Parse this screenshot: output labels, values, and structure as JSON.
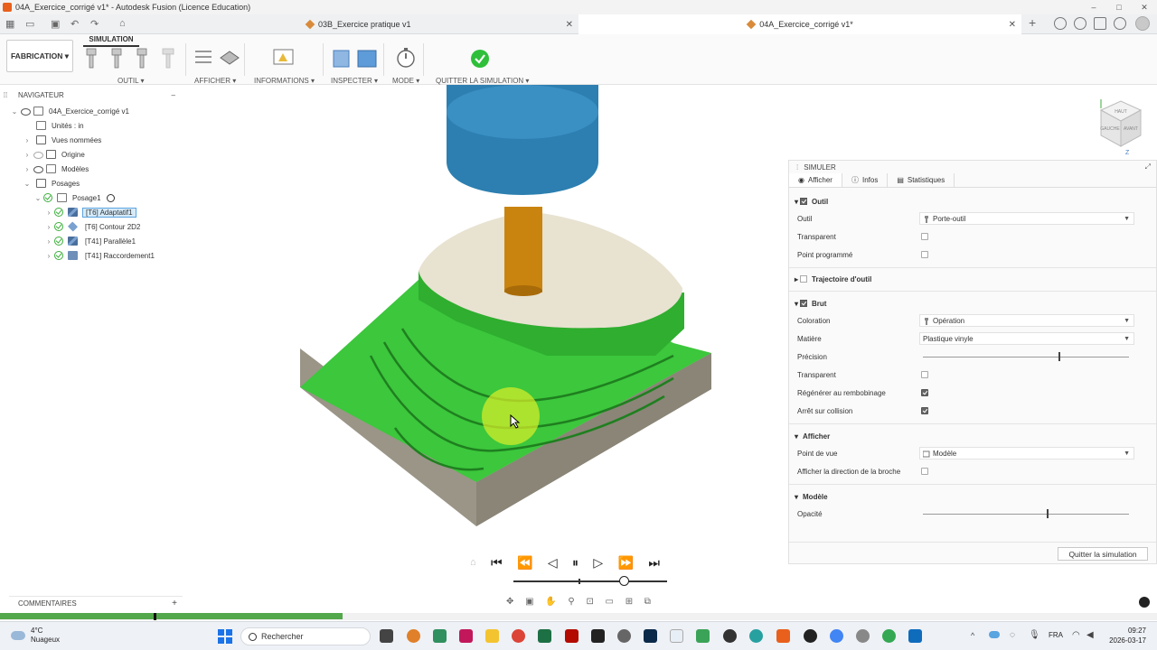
{
  "window": {
    "title": "04A_Exercice_corrigé v1* - Autodesk Fusion (Licence Education)",
    "controls": [
      "–",
      "□",
      "✕"
    ]
  },
  "tabs": [
    {
      "label": "03B_Exercice pratique v1",
      "close": "✕"
    },
    {
      "label": "04A_Exercice_corrigé v1*",
      "close": "✕"
    }
  ],
  "toolbar": {
    "workspace": "FABRICATION",
    "active_tab": "SIMULATION",
    "groups": {
      "outil": "OUTIL ▾",
      "afficher": "AFFICHER ▾",
      "informations": "INFORMATIONS ▾",
      "inspecter": "INSPECTER ▾",
      "mode": "MODE ▾",
      "quitter": "QUITTER LA SIMULATION ▾"
    }
  },
  "navigator": {
    "title": "NAVIGATEUR",
    "collapse": "–",
    "root": "04A_Exercice_corrigé v1",
    "units": "Unités : in",
    "items": [
      "Vues nommées",
      "Origine",
      "Modèles",
      "Posages"
    ],
    "setup": "Posage1",
    "operations": [
      "[T6] Adaptatif1",
      "[T6] Contour 2D2",
      "[T41] Parallèle1",
      "[T41] Raccordement1"
    ]
  },
  "comments": {
    "label": "COMMENTAIRES",
    "add": "+"
  },
  "simulation_panel": {
    "title": "SIMULER",
    "tabs": [
      "Afficher",
      "Infos",
      "Statistiques"
    ],
    "outil_section": "Outil",
    "outil": {
      "label": "Outil",
      "value": "Porte-outil"
    },
    "transparent_label": "Transparent",
    "point_programme_label": "Point programmé",
    "trajectoire_section": "Trajectoire d'outil",
    "brut_section": "Brut",
    "coloration": {
      "label": "Coloration",
      "value": "Opération"
    },
    "matiere": {
      "label": "Matière",
      "value": "Plastique vinyle"
    },
    "precision": {
      "label": "Précision",
      "value": 0.66
    },
    "transparent2_label": "Transparent",
    "regenerer_label": "Régénérer au rembobinage",
    "arret_label": "Arrêt sur collision",
    "afficher_section": "Afficher",
    "point_de_vue": {
      "label": "Point de vue",
      "value": "Modèle"
    },
    "direction_broche_label": "Afficher la direction de la broche",
    "modele_section": "Modèle",
    "opacite": {
      "label": "Opacité",
      "value": 0.6
    },
    "quit_button": "Quitter la simulation",
    "checkboxes": {
      "outil": true,
      "transparent": false,
      "point_programme": false,
      "trajectoire": false,
      "brut": true,
      "transparent2": false,
      "regenerer": true,
      "arret": true,
      "direction_broche": false
    }
  },
  "playback": {
    "controls": [
      "⏮",
      "⏪",
      "◁",
      "⏸",
      "▷",
      "⏩",
      "⏭"
    ],
    "position": 0.72,
    "progress": 0.296
  },
  "viewcube": {
    "top": "HAUT",
    "left": "GAUCHE",
    "front": "AVANT",
    "z": "Z"
  },
  "taskbar": {
    "weather_temp": "4°C",
    "weather_desc": "Nuageux",
    "search_placeholder": "Rechercher",
    "lang": "FRA",
    "time": "09:27",
    "date": "2026-03-17"
  },
  "colors": {
    "machined_green": "#3cc73c",
    "tool_holder": "#2c7fb0",
    "tool": "#c9840f",
    "stock_top": "#e8e2d1",
    "stock_side": "#9a9587",
    "progress_green": "#52a84a"
  }
}
